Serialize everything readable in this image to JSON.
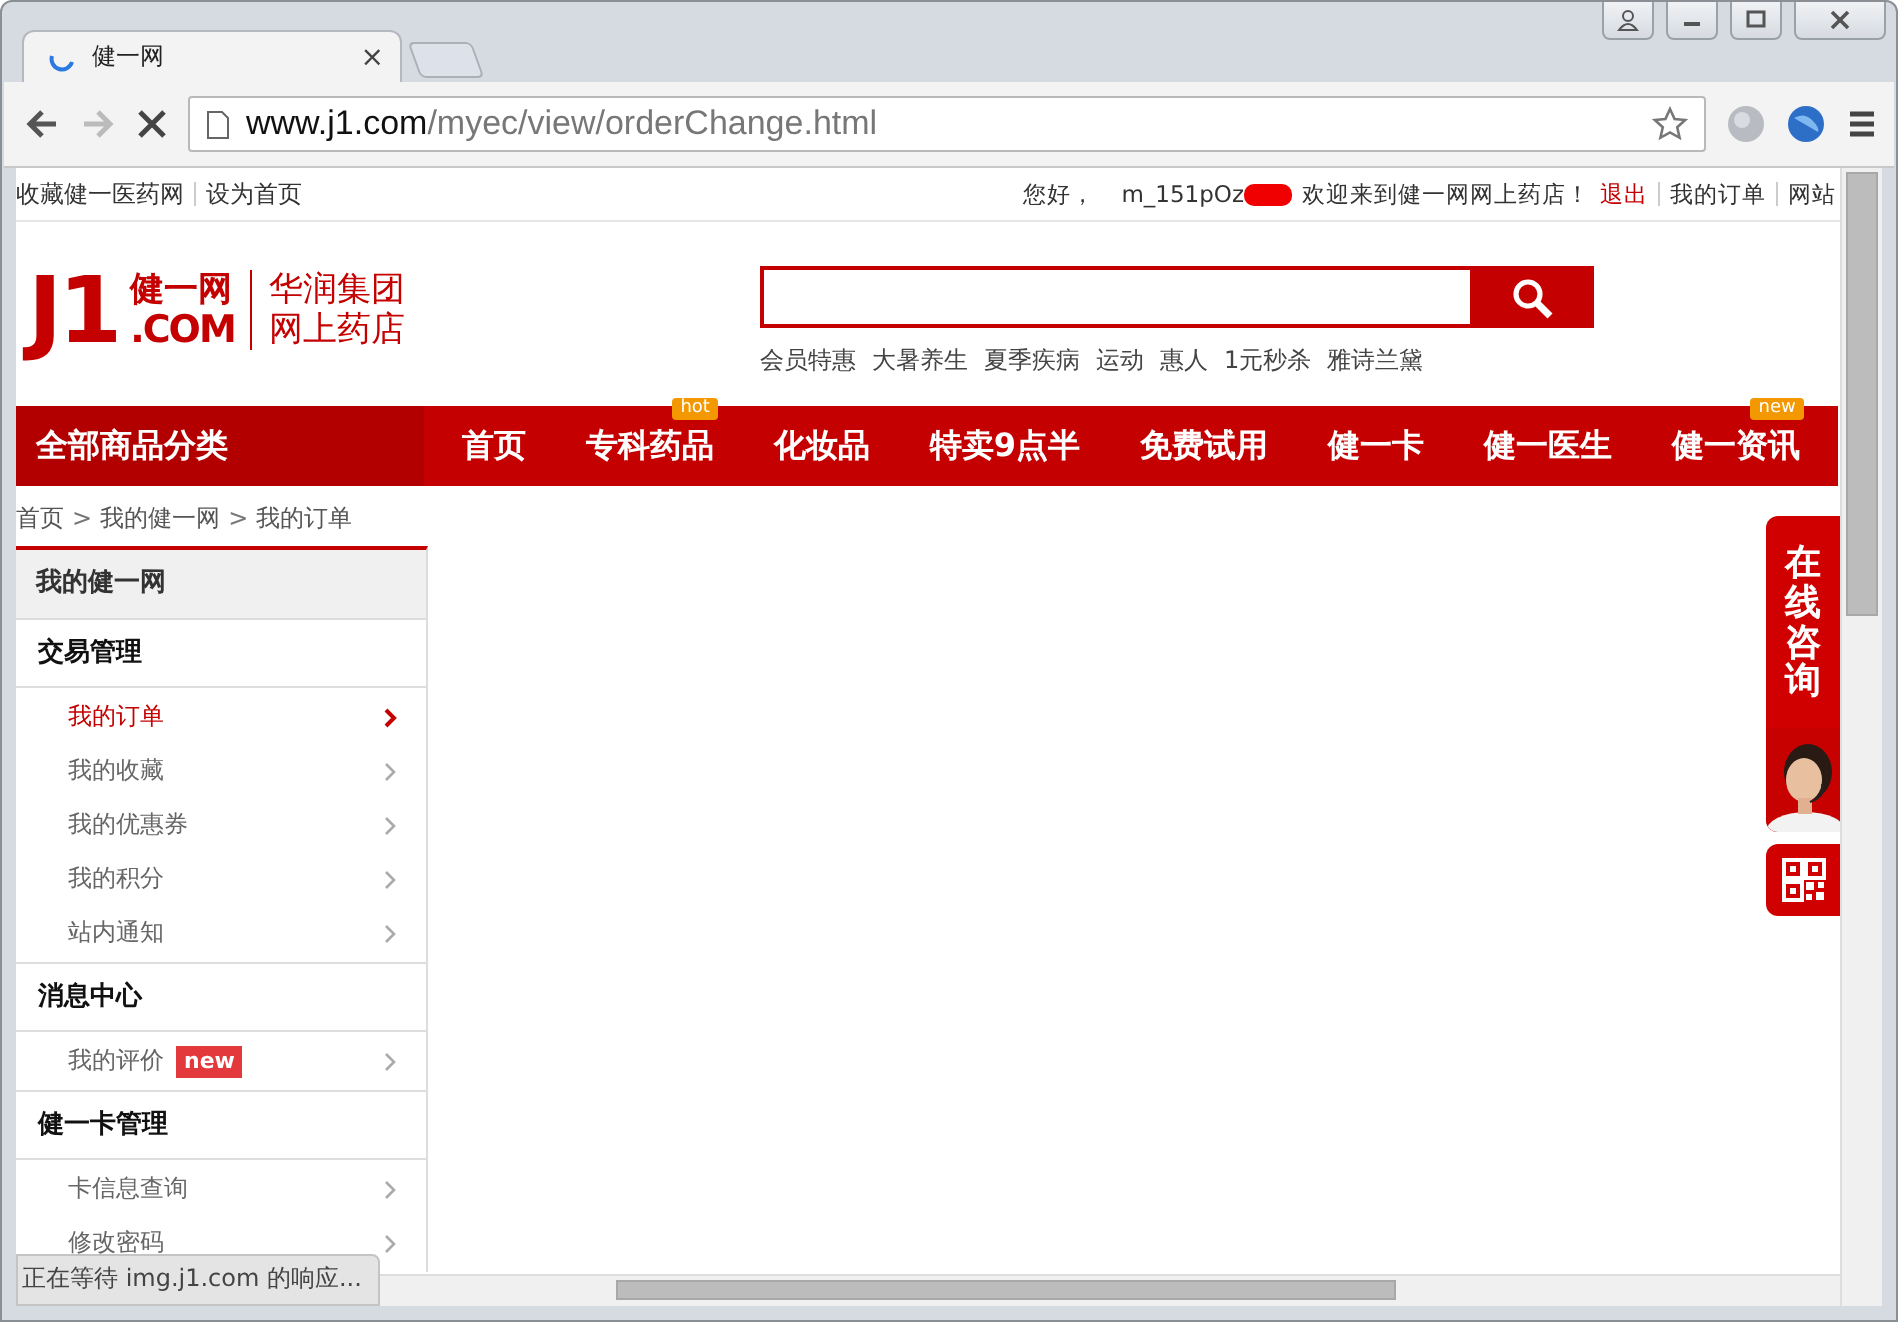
{
  "browser": {
    "tab": {
      "title": "健一网",
      "close": "×"
    },
    "url": {
      "host": "www.j1.com",
      "path": "/myec/view/orderChange.html"
    },
    "status": "正在等待 img.j1.com 的响应..."
  },
  "topbar": {
    "left": [
      "收藏健一医药网",
      "设为首页"
    ],
    "greeting": "您好，",
    "user": "m_151pOz",
    "welcome": "欢迎来到健一网网上药店！",
    "logout": "退出",
    "right": [
      "我的订单",
      "网站"
    ]
  },
  "header": {
    "logo": {
      "mark": "J1",
      "com": ".COM",
      "name": "健一网",
      "group": "华润集团",
      "store": "网上药店"
    },
    "hot_words": [
      "会员特惠",
      "大暑养生",
      "夏季疾病",
      "运动",
      "惠人",
      "1元秒杀",
      "雅诗兰黛"
    ]
  },
  "nav": {
    "category": "全部商品分类",
    "items": [
      {
        "label": "首页"
      },
      {
        "label": "专科药品",
        "badge": "hot"
      },
      {
        "label": "化妆品"
      },
      {
        "label": "特卖9点半"
      },
      {
        "label": "免费试用"
      },
      {
        "label": "健一卡"
      },
      {
        "label": "健一医生"
      },
      {
        "label": "健一资讯",
        "badge": "new"
      }
    ]
  },
  "breadcrumb": [
    {
      "kind": "link",
      "text": "首页"
    },
    {
      "kind": "sep",
      "text": ">"
    },
    {
      "kind": "link",
      "text": "我的健一网"
    },
    {
      "kind": "sep",
      "text": ">"
    },
    {
      "kind": "link",
      "text": "我的订单"
    }
  ],
  "sidebar": {
    "title": "我的健一网",
    "sections": [
      {
        "title": "交易管理",
        "items": [
          {
            "label": "我的订单",
            "selected": true
          },
          {
            "label": "我的收藏",
            "selected": false
          },
          {
            "label": "我的优惠券",
            "selected": false
          },
          {
            "label": "我的积分",
            "selected": false
          },
          {
            "label": "站内通知",
            "selected": false
          }
        ]
      },
      {
        "title": "消息中心",
        "items": [
          {
            "label": "我的评价",
            "selected": false,
            "badge": "new"
          }
        ]
      },
      {
        "title": "健一卡管理",
        "items": [
          {
            "label": "卡信息查询",
            "selected": false
          },
          {
            "label": "修改密码",
            "selected": false
          }
        ]
      }
    ]
  },
  "consult": {
    "label": "在线咨询"
  }
}
